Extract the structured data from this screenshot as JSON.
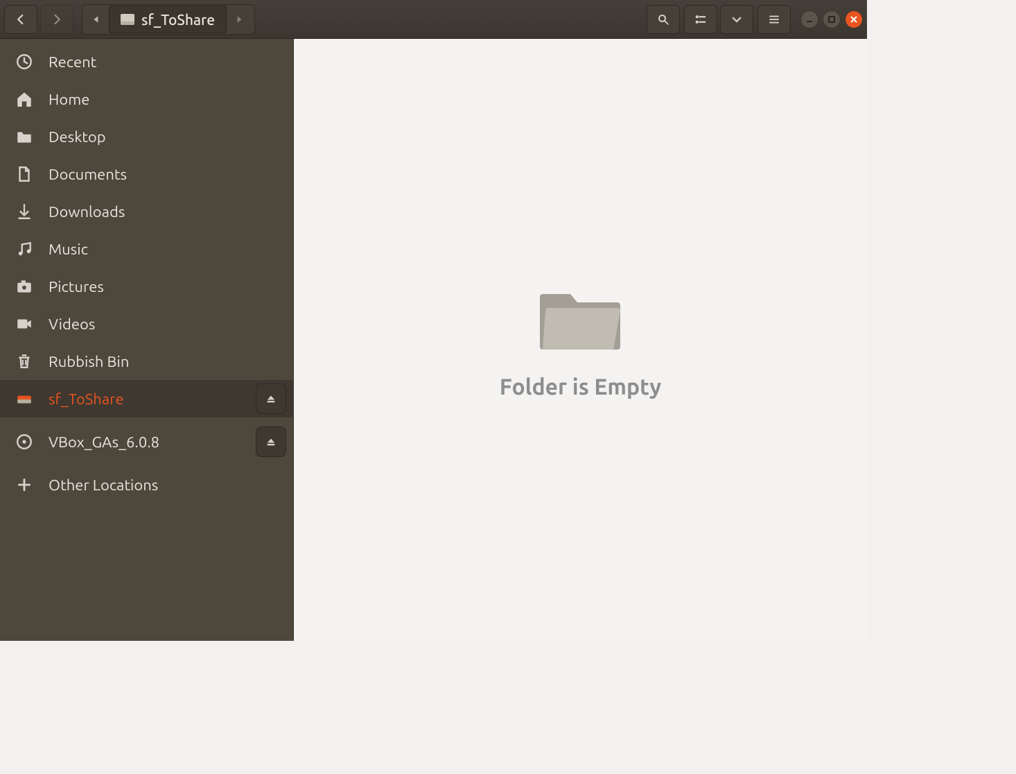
{
  "header": {
    "location_label": "sf_ToShare"
  },
  "sidebar": {
    "items": [
      {
        "label": "Recent",
        "icon": "clock",
        "active": false,
        "ejectable": false
      },
      {
        "label": "Home",
        "icon": "home",
        "active": false,
        "ejectable": false
      },
      {
        "label": "Desktop",
        "icon": "folder",
        "active": false,
        "ejectable": false
      },
      {
        "label": "Documents",
        "icon": "document",
        "active": false,
        "ejectable": false
      },
      {
        "label": "Downloads",
        "icon": "download",
        "active": false,
        "ejectable": false
      },
      {
        "label": "Music",
        "icon": "music",
        "active": false,
        "ejectable": false
      },
      {
        "label": "Pictures",
        "icon": "camera",
        "active": false,
        "ejectable": false
      },
      {
        "label": "Videos",
        "icon": "video",
        "active": false,
        "ejectable": false
      },
      {
        "label": "Rubbish Bin",
        "icon": "trash",
        "active": false,
        "ejectable": false
      },
      {
        "label": "sf_ToShare",
        "icon": "drive",
        "active": true,
        "ejectable": true
      },
      {
        "label": "VBox_GAs_6.0.8",
        "icon": "disc",
        "active": false,
        "ejectable": true
      },
      {
        "label": "Other Locations",
        "icon": "plus",
        "active": false,
        "ejectable": false
      }
    ]
  },
  "content": {
    "empty_message": "Folder is Empty"
  }
}
